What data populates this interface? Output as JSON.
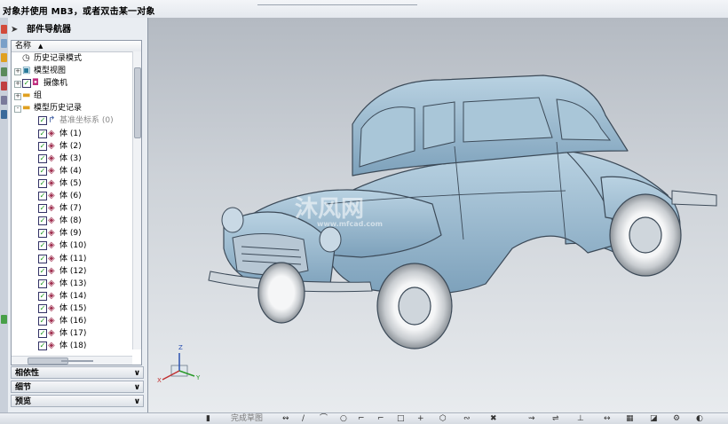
{
  "prompt_text": "对象并使用 MB3，或者双击某一对象",
  "navigator": {
    "title": "部件导航器",
    "column_header": "名称",
    "tree": [
      {
        "label": "历史记录模式",
        "icon": "clock-icon",
        "indent": 1
      },
      {
        "label": "模型视图",
        "icon": "view-icon",
        "indent": 1,
        "expand": "+"
      },
      {
        "label": "摄像机",
        "icon": "camera-icon",
        "indent": 1,
        "expand": "+",
        "checked": true
      },
      {
        "label": "组",
        "icon": "folder-icon",
        "indent": 1,
        "expand": "+"
      },
      {
        "label": "模型历史记录",
        "icon": "folder-icon",
        "indent": 1,
        "expand": "-"
      },
      {
        "label": "基准坐标系 (0)",
        "icon": "csys-icon",
        "indent": 2,
        "checked": true,
        "dim": true
      },
      {
        "label": "体 (1)",
        "icon": "body-icon",
        "indent": 2,
        "checked": true
      },
      {
        "label": "体 (2)",
        "icon": "body-icon",
        "indent": 2,
        "checked": true
      },
      {
        "label": "体 (3)",
        "icon": "body-icon",
        "indent": 2,
        "checked": true
      },
      {
        "label": "体 (4)",
        "icon": "body-icon",
        "indent": 2,
        "checked": true
      },
      {
        "label": "体 (5)",
        "icon": "body-icon",
        "indent": 2,
        "checked": true
      },
      {
        "label": "体 (6)",
        "icon": "body-icon",
        "indent": 2,
        "checked": true
      },
      {
        "label": "体 (7)",
        "icon": "body-icon",
        "indent": 2,
        "checked": true
      },
      {
        "label": "体 (8)",
        "icon": "body-icon",
        "indent": 2,
        "checked": true
      },
      {
        "label": "体 (9)",
        "icon": "body-icon",
        "indent": 2,
        "checked": true
      },
      {
        "label": "体 (10)",
        "icon": "body-icon",
        "indent": 2,
        "checked": true
      },
      {
        "label": "体 (11)",
        "icon": "body-icon",
        "indent": 2,
        "checked": true
      },
      {
        "label": "体 (12)",
        "icon": "body-icon",
        "indent": 2,
        "checked": true
      },
      {
        "label": "体 (13)",
        "icon": "body-icon",
        "indent": 2,
        "checked": true
      },
      {
        "label": "体 (14)",
        "icon": "body-icon",
        "indent": 2,
        "checked": true
      },
      {
        "label": "体 (15)",
        "icon": "body-icon",
        "indent": 2,
        "checked": true
      },
      {
        "label": "体 (16)",
        "icon": "body-icon",
        "indent": 2,
        "checked": true
      },
      {
        "label": "体 (17)",
        "icon": "body-icon",
        "indent": 2,
        "checked": true
      },
      {
        "label": "体 (18)",
        "icon": "body-icon",
        "indent": 2,
        "checked": true
      }
    ],
    "sections": [
      {
        "label": "相依性",
        "icon": "chevron-down-icon"
      },
      {
        "label": "细节",
        "icon": "chevron-down-icon"
      },
      {
        "label": "预览",
        "icon": "chevron-down-icon"
      }
    ]
  },
  "viewport": {
    "watermark_text": "沐风网",
    "watermark_url": "www.mfcad.com",
    "triad": {
      "x": "X",
      "y": "Y",
      "z": "Z"
    }
  },
  "bottom_toolbar": {
    "label": "完成草图"
  },
  "colors": {
    "model_fill": "#8fb3cc",
    "model_edge": "#3c4a58",
    "check_green": "#1a9a1a",
    "viewport_top": "#b4bac2",
    "viewport_bottom": "#e8ebee"
  }
}
